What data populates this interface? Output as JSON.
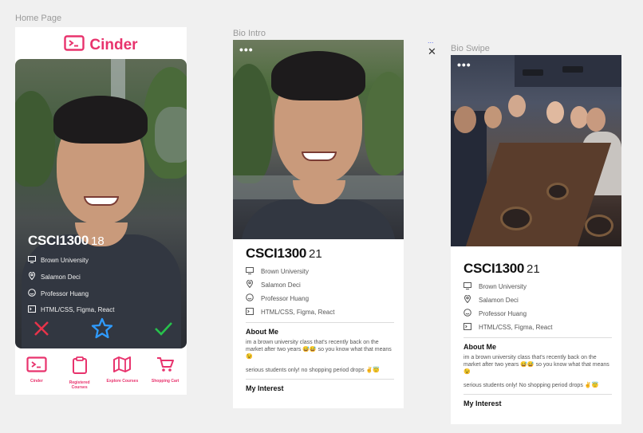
{
  "frames": {
    "home_label": "Home Page",
    "bio_intro_label": "Bio Intro",
    "bio_swipe_label": "Bio Swipe"
  },
  "brand": {
    "name": "Cinder",
    "color": "#e8336d"
  },
  "home": {
    "course": "CSCI1300",
    "age": "18",
    "details": [
      "Brown University",
      "Salamon Deci",
      "Professor Huang",
      "HTML/CSS, Figma, React"
    ],
    "actions": [
      {
        "name": "reject",
        "icon": "x-icon",
        "color": "#e8334a"
      },
      {
        "name": "favorite",
        "icon": "star-icon",
        "color": "#2f9bff"
      },
      {
        "name": "accept",
        "icon": "check-icon",
        "color": "#27c24c"
      }
    ],
    "tabs": [
      {
        "label": "Cinder",
        "icon": "terminal-icon"
      },
      {
        "label": "Registered Courses",
        "icon": "clipboard-icon"
      },
      {
        "label": "Explore Courses",
        "icon": "map-icon"
      },
      {
        "label": "Shopping Cart",
        "icon": "cart-icon"
      }
    ]
  },
  "bio": {
    "course": "CSCI1300",
    "age": "21",
    "details": [
      "Brown University",
      "Salamon Deci",
      "Professor Huang",
      "HTML/CSS, Figma, React"
    ],
    "about_heading": "About Me",
    "about_text_1": "im a brown university class that's recently back on the market after two years 😅😅 so you know what that means 😉",
    "about_text_2": "serious students only! no shopping period drops ✌️😇",
    "interest_heading": "My Interest",
    "menu_dots": "•••"
  },
  "bio_swipe": {
    "about_text_2": "serious students only! No shopping period drops ✌️😇"
  },
  "canvas": {
    "close_glyph": "✕",
    "mini_dots": "..."
  }
}
